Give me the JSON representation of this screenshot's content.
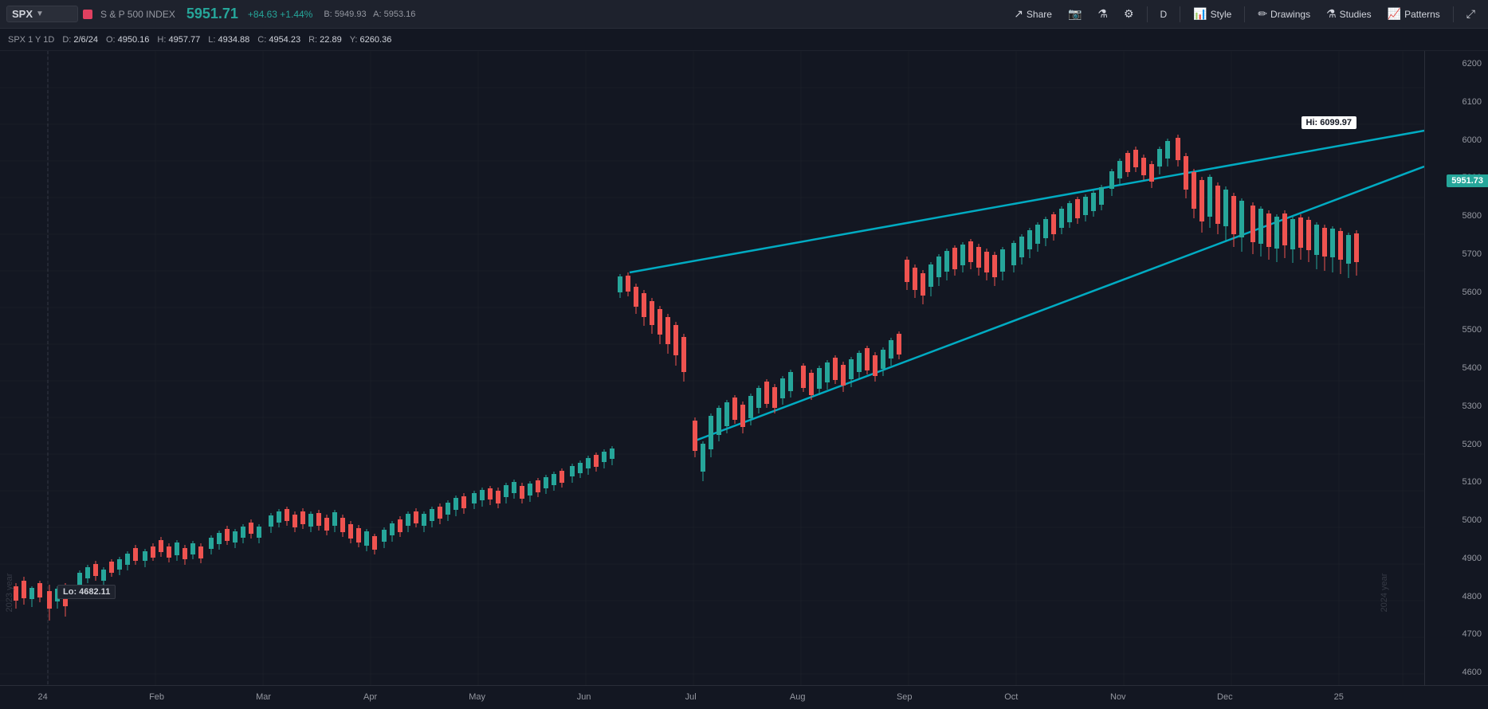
{
  "header": {
    "symbol": "SPX",
    "red_square": true,
    "instrument_name": "S & P 500 INDEX",
    "price_main": "5951.71",
    "change": "+84.63",
    "change_pct": "+1.44%",
    "bid_label": "B:",
    "bid": "5949.93",
    "ask_label": "A:",
    "ask": "5953.16"
  },
  "ohlc": {
    "timeframe": "SPX 1 Y 1D",
    "date_label": "D:",
    "date": "2/6/24",
    "open_label": "O:",
    "open": "4950.16",
    "high_label": "H:",
    "high": "4957.77",
    "low_label": "L:",
    "low": "4934.88",
    "close_label": "C:",
    "close": "4954.23",
    "r_label": "R:",
    "r": "22.89",
    "y_label": "Y:",
    "y": "6260.36"
  },
  "toolbar": {
    "share_label": "Share",
    "timeframe_label": "D",
    "style_label": "Style",
    "drawings_label": "Drawings",
    "studies_label": "Studies",
    "patterns_label": "Patterns"
  },
  "chart": {
    "hi_label": "Hi: 6099.97",
    "lo_label": "Lo: 4682.11",
    "current_price": "5951.73",
    "price_ticks": [
      "6200",
      "6100",
      "6000",
      "5900",
      "5800",
      "5700",
      "5600",
      "5500",
      "5400",
      "5300",
      "5200",
      "5100",
      "5000",
      "4900",
      "4800",
      "4700",
      "4600"
    ],
    "time_labels": [
      "24",
      "Feb",
      "Mar",
      "Apr",
      "May",
      "Jun",
      "Jul",
      "Aug",
      "Sep",
      "Oct",
      "Nov",
      "Dec",
      "25"
    ],
    "year_labels": [
      "2023 year",
      "2024 year"
    ]
  }
}
